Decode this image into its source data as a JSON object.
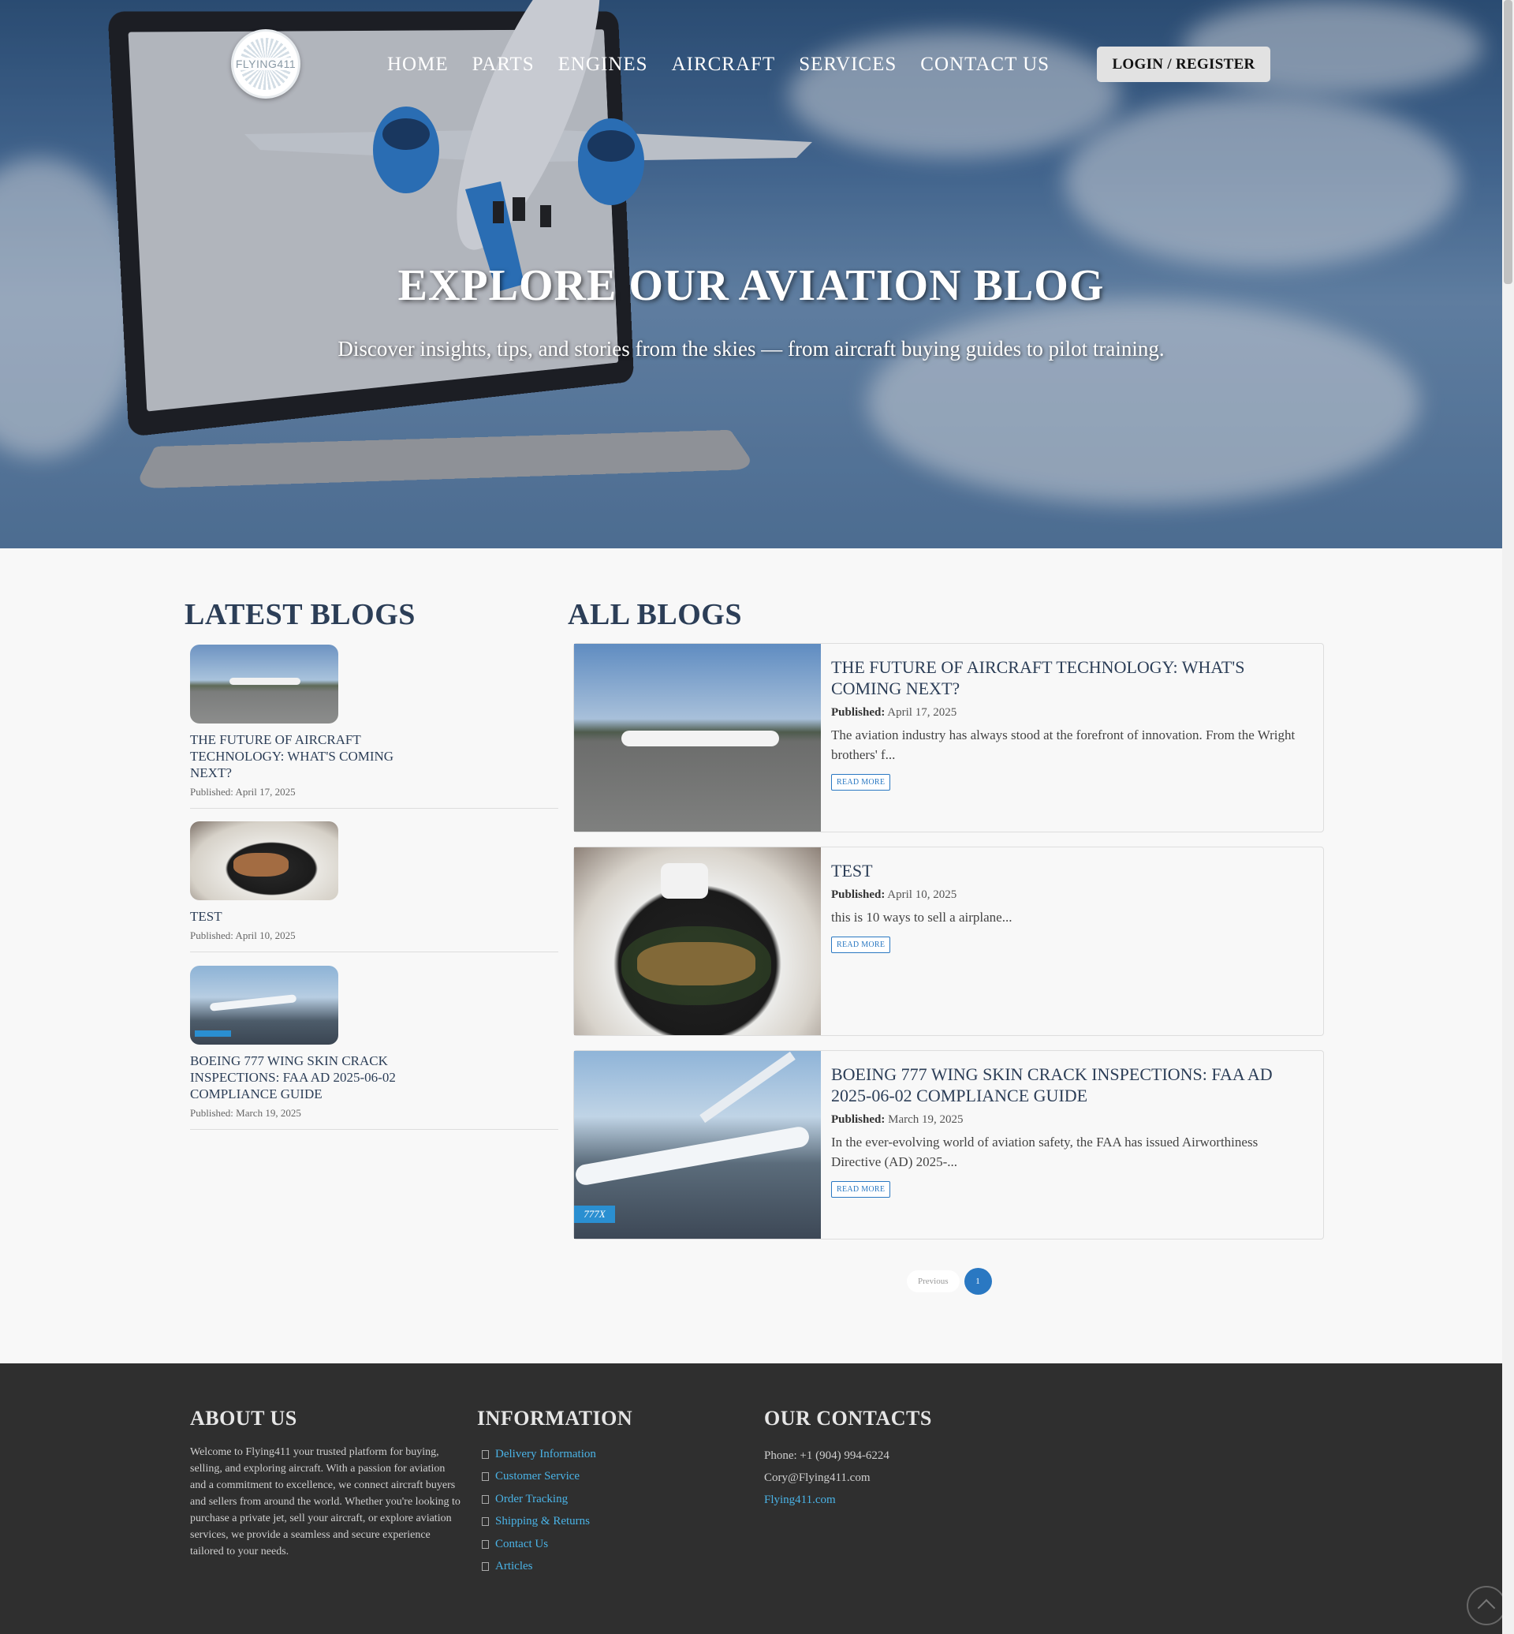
{
  "brand": {
    "logo_text": "FLYING411"
  },
  "nav": {
    "items": [
      "HOME",
      "PARTS",
      "ENGINES",
      "AIRCRAFT",
      "SERVICES",
      "CONTACT US"
    ],
    "login_label": "LOGIN / REGISTER"
  },
  "hero": {
    "title": "EXPLORE OUR AVIATION BLOG",
    "subtitle": "Discover insights, tips, and stories from the skies — from aircraft buying guides to pilot training."
  },
  "latest": {
    "heading": "LATEST BLOGS",
    "items": [
      {
        "title": "THE FUTURE OF AIRCRAFT TECHNOLOGY: WHAT'S COMING NEXT?",
        "date": "Published: April 17, 2025"
      },
      {
        "title": "TEST",
        "date": "Published: April 10, 2025"
      },
      {
        "title": "BOEING 777 WING SKIN CRACK INSPECTIONS: FAA AD 2025-06-02 COMPLIANCE GUIDE",
        "date": "Published: March 19, 2025"
      }
    ]
  },
  "all": {
    "heading": "ALL BLOGS",
    "published_label": "Published:",
    "read_more": "READ MORE",
    "posts": [
      {
        "title": "THE FUTURE OF AIRCRAFT TECHNOLOGY: WHAT'S COMING NEXT?",
        "date": "April 17, 2025",
        "excerpt": "The aviation industry has always stood at the forefront of innovation. From the Wright brothers' f..."
      },
      {
        "title": "TEST",
        "date": "April 10, 2025",
        "excerpt": "this is 10 ways to sell a airplane..."
      },
      {
        "title": "BOEING 777 WING SKIN CRACK INSPECTIONS: FAA AD 2025-06-02 COMPLIANCE GUIDE",
        "date": "March 19, 2025",
        "excerpt": "In the ever-evolving world of aviation safety, the FAA has issued Airworthiness Directive (AD) 2025-..."
      }
    ],
    "badge_text": "777X"
  },
  "pagination": {
    "prev_label": "Previous",
    "current_page": "1"
  },
  "footer": {
    "about": {
      "heading": "ABOUT US",
      "text": "Welcome to Flying411 your trusted platform for buying, selling, and exploring aircraft. With a passion for aviation and a commitment to excellence, we connect aircraft buyers and sellers from around the world. Whether you're looking to purchase a private jet, sell your aircraft, or explore aviation services, we provide a seamless and secure experience tailored to your needs."
    },
    "information": {
      "heading": "INFORMATION",
      "links": [
        "Delivery Information",
        "Customer Service",
        "Order Tracking",
        "Shipping & Returns",
        "Contact Us",
        "Articles"
      ]
    },
    "contacts": {
      "heading": "OUR CONTACTS",
      "phone": "Phone: +1 (904) 994-6224",
      "email": "Cory@Flying411.com",
      "website": "Flying411.com"
    }
  },
  "colors": {
    "accent": "#2a78c2",
    "heading": "#2c3e57",
    "footer_bg": "#2f2f2f",
    "footer_link": "#4ab3e6"
  }
}
